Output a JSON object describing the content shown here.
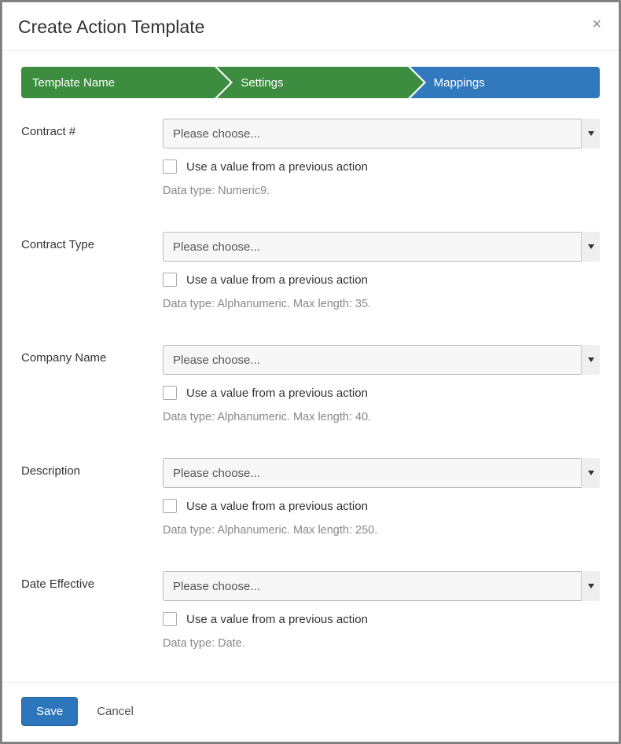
{
  "modal": {
    "title": "Create Action Template",
    "close_glyph": "×"
  },
  "wizard": {
    "steps": [
      {
        "label": "Template Name",
        "state": "done"
      },
      {
        "label": "Settings",
        "state": "done"
      },
      {
        "label": "Mappings",
        "state": "active"
      }
    ]
  },
  "fields": [
    {
      "label": "Contract #",
      "select_placeholder": "Please choose...",
      "checkbox_label": "Use a value from a previous action",
      "hint": "Data type: Numeric9."
    },
    {
      "label": "Contract Type",
      "select_placeholder": "Please choose...",
      "checkbox_label": "Use a value from a previous action",
      "hint": "Data type: Alphanumeric. Max length: 35."
    },
    {
      "label": "Company Name",
      "select_placeholder": "Please choose...",
      "checkbox_label": "Use a value from a previous action",
      "hint": "Data type: Alphanumeric. Max length: 40."
    },
    {
      "label": "Description",
      "select_placeholder": "Please choose...",
      "checkbox_label": "Use a value from a previous action",
      "hint": "Data type: Alphanumeric. Max length: 250."
    },
    {
      "label": "Date Effective",
      "select_placeholder": "Please choose...",
      "checkbox_label": "Use a value from a previous action",
      "hint": "Data type: Date."
    }
  ],
  "footer": {
    "save_label": "Save",
    "cancel_label": "Cancel"
  }
}
